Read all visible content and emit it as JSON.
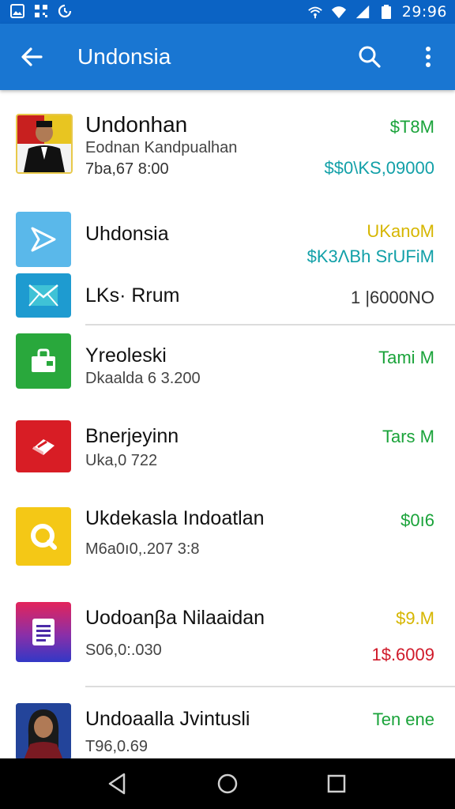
{
  "status_bar": {
    "time": "29:96",
    "icons": [
      "image-icon",
      "grid-icon",
      "sync-icon",
      "hotspot-icon",
      "wifi-icon",
      "signal-icon",
      "battery-icon"
    ]
  },
  "app_bar": {
    "title": "Undonsia"
  },
  "list": [
    {
      "title": "Undonhan",
      "subtitle": "Eodnan Kandpualhan",
      "detail": "7ba,67 8:00",
      "amount_top": "$T8M",
      "amount_top_color": "#1aa33a",
      "amount_bottom": "$$0\\KS,09000",
      "amount_bottom_color": "#12a0a8",
      "icon": "portrait-man"
    },
    {
      "title": "Uhdonsia",
      "amount_top": "UKanoM",
      "amount_top_color": "#d6b600",
      "amount_bottom": "$K3ΛBh SrUFiM",
      "amount_bottom_color": "#12a0a8",
      "icon": "play-arrow-icon"
    },
    {
      "title": "LKs· Rrum",
      "amount_top": "1 |6000NO",
      "amount_top_color": "#333333",
      "icon": "mail-icon"
    },
    {
      "title": "Yreoleski",
      "subtitle": "Dkaalda 6 3.200",
      "amount_top": "Tami M",
      "amount_top_color": "#1aa33a",
      "icon": "bag-icon"
    },
    {
      "title": "Bnerjeyinn",
      "subtitle": "Uka,0 722",
      "amount_top": "Tars M",
      "amount_top_color": "#1aa33a",
      "icon": "eraser-icon"
    },
    {
      "title": "Ukdekasla Indoatlan",
      "subtitle": "M6a0ı0,.207 3:8",
      "amount_top": "$0ı6",
      "amount_top_color": "#1aa33a",
      "icon": "search-circle-icon"
    },
    {
      "title": "Uodoanβa Nilaaidan",
      "subtitle": "S06,0:.030",
      "amount_top": "$9.M",
      "amount_top_color": "#d6b600",
      "amount_bottom": "1$.6009",
      "amount_bottom_color": "#d01a2a",
      "icon": "document-icon"
    },
    {
      "title": "Undoaalla Jvintusli",
      "subtitle": "T96,0.69",
      "amount_top": "Ten ene",
      "amount_top_color": "#1aa33a",
      "icon": "portrait-woman"
    }
  ],
  "nav_bar": {
    "icons": [
      "back-triangle-icon",
      "home-circle-icon",
      "recents-square-icon"
    ]
  }
}
